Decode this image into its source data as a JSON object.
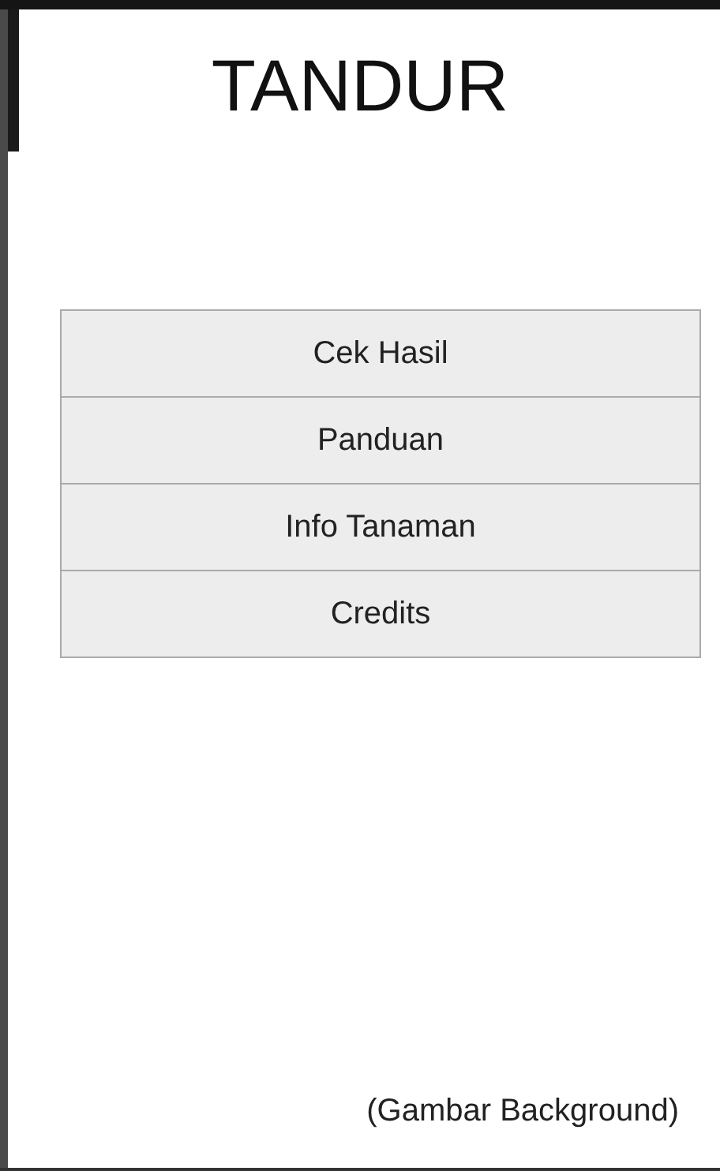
{
  "title": "TANDUR",
  "menu": [
    {
      "label": "Cek Hasil"
    },
    {
      "label": "Panduan"
    },
    {
      "label": "Info Tanaman"
    },
    {
      "label": "Credits"
    }
  ],
  "note": "(Gambar Background)"
}
